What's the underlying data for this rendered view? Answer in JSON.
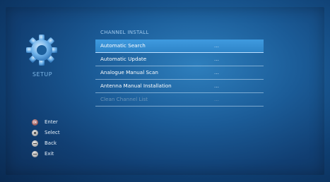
{
  "sidebar": {
    "logo_icon": "gear-icon",
    "label": "SETUP"
  },
  "menu": {
    "title": "CHANNEL INSTALL",
    "items": [
      {
        "label": "Automatic Search",
        "value": "...",
        "selected": true,
        "disabled": false
      },
      {
        "label": "Automatic Update",
        "value": "...",
        "selected": false,
        "disabled": false
      },
      {
        "label": "Analogue Manual Scan",
        "value": "...",
        "selected": false,
        "disabled": false
      },
      {
        "label": "Antenna Manual Installation",
        "value": "...",
        "selected": false,
        "disabled": false
      },
      {
        "label": "Clean Channel List",
        "value": "...",
        "selected": false,
        "disabled": true
      }
    ]
  },
  "legend": {
    "items": [
      {
        "icon": "ok-button-icon",
        "key_text": "OK",
        "label": "Enter"
      },
      {
        "icon": "select-button-icon",
        "label": "Select"
      },
      {
        "icon": "back-button-icon",
        "label": "Back"
      },
      {
        "icon": "exit-button-icon",
        "label": "Exit"
      }
    ]
  },
  "colors": {
    "background": "#1b5c98",
    "highlight": "#3f9be0",
    "text": "#ffffff",
    "disabled_text": "#6b94b8",
    "accent_label": "#7db6e6"
  }
}
